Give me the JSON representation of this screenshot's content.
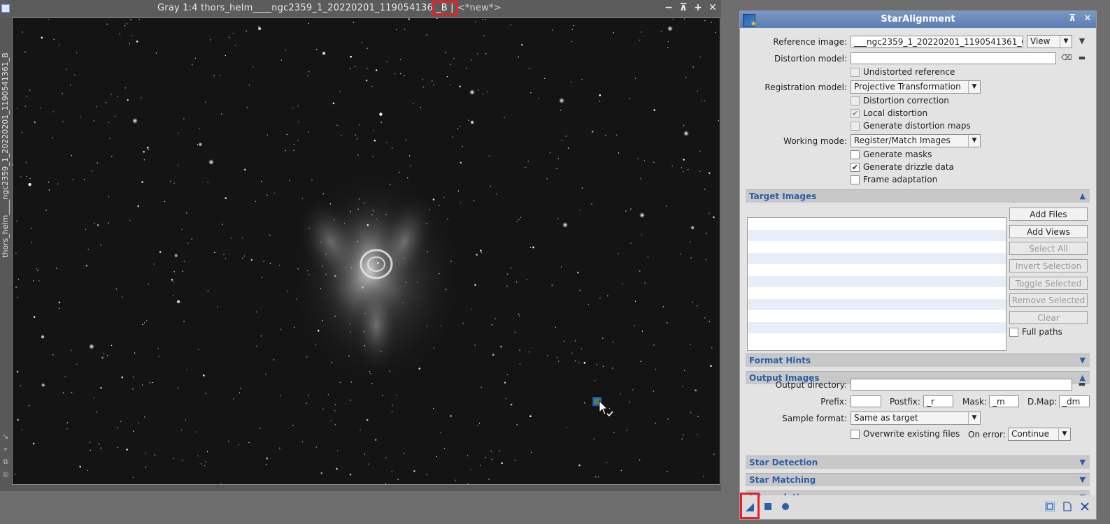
{
  "image_window": {
    "title_prefix": "Gray 1:4 thors_helm____ngc2359_1_20220201_119054136",
    "title_highlight": "_B |",
    "title_suffix": "<*new*>",
    "side_label": "thors_helm____ngc2359_1_20220201_1190541361_B",
    "buttons": {
      "minimize": "−",
      "shade": "⊼",
      "maximize": "+",
      "close": "✕"
    }
  },
  "panel": {
    "title": "StarAlignment",
    "reference_image": {
      "label": "Reference image:",
      "value": "___ngc2359_1_20220201_1190541361_G",
      "mode": "View"
    },
    "distortion_model": {
      "label": "Distortion model:",
      "value": ""
    },
    "undistorted_reference": {
      "label": "Undistorted reference",
      "checked": false,
      "enabled": false
    },
    "registration_model": {
      "label": "Registration model:",
      "value": "Projective Transformation"
    },
    "distortion_correction": {
      "label": "Distortion correction",
      "checked": false,
      "enabled": false
    },
    "local_distortion": {
      "label": "Local distortion",
      "checked": true,
      "enabled": false
    },
    "generate_distortion_maps": {
      "label": "Generate distortion maps",
      "checked": false,
      "enabled": false
    },
    "working_mode": {
      "label": "Working mode:",
      "value": "Register/Match Images"
    },
    "generate_masks": {
      "label": "Generate masks",
      "checked": false
    },
    "generate_drizzle_data": {
      "label": "Generate drizzle data",
      "checked": true
    },
    "frame_adaptation": {
      "label": "Frame adaptation",
      "checked": false
    },
    "sections": {
      "target_images": "Target Images",
      "format_hints": "Format Hints",
      "output_images": "Output Images",
      "star_detection": "Star Detection",
      "star_matching": "Star Matching",
      "interpolation": "Interpolation"
    },
    "target_buttons": {
      "add_files": "Add Files",
      "add_views": "Add Views",
      "select_all": "Select All",
      "invert_selection": "Invert Selection",
      "toggle_selected": "Toggle Selected",
      "remove_selected": "Remove Selected",
      "clear": "Clear"
    },
    "full_paths": {
      "label": "Full paths",
      "checked": false
    },
    "output": {
      "directory_label": "Output directory:",
      "directory_value": "",
      "prefix_label": "Prefix:",
      "prefix_value": "",
      "postfix_label": "Postfix:",
      "postfix_value": "_r",
      "mask_label": "Mask:",
      "mask_value": "_m",
      "dmap_label": "D.Map:",
      "dmap_value": "_dm",
      "sample_format_label": "Sample format:",
      "sample_format_value": "Same as target",
      "overwrite_label": "Overwrite existing files",
      "overwrite_checked": false,
      "on_error_label": "On error:",
      "on_error_value": "Continue"
    }
  },
  "colors": {
    "accent": "#2b5fa6",
    "titlebar": "#5d7fb4",
    "highlight_box": "#e8202a"
  }
}
